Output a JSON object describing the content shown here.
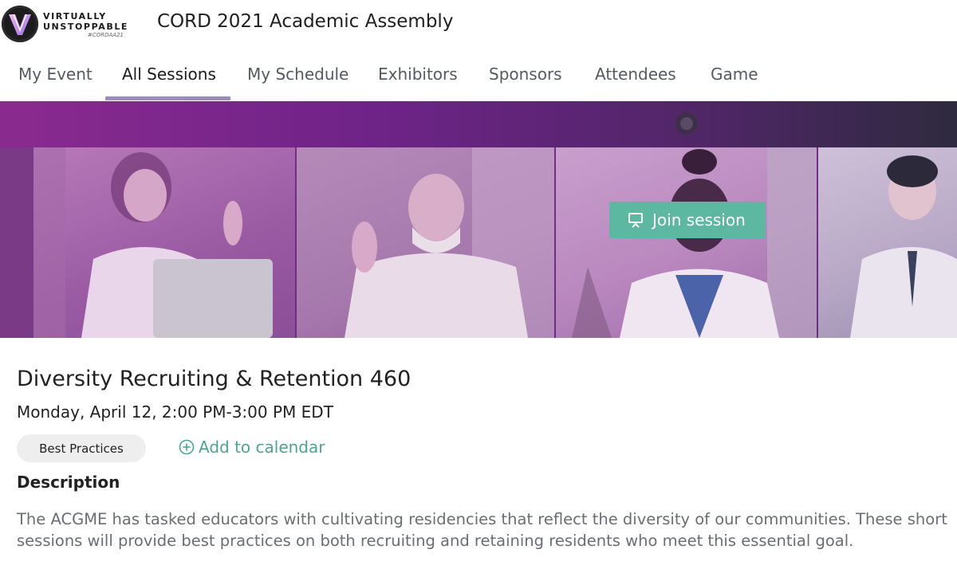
{
  "brand": {
    "logo_line1": "VIRTUALLY",
    "logo_line2": "UNSTOPPABLE",
    "logo_tag": "#CORDAA21",
    "accent_color": "#9a8bc3",
    "button_color": "#5cb8a0"
  },
  "header": {
    "title": "CORD 2021 Academic Assembly"
  },
  "nav": {
    "tabs": [
      {
        "label": "My Event"
      },
      {
        "label": "All Sessions",
        "active": true
      },
      {
        "label": "My Schedule"
      },
      {
        "label": "Exhibitors"
      },
      {
        "label": "Sponsors"
      },
      {
        "label": "Attendees"
      },
      {
        "label": "Game"
      }
    ]
  },
  "banner": {
    "join_label": "Join session",
    "join_icon": "presentation-icon"
  },
  "session": {
    "title": "Diversity Recruiting & Retention 460",
    "datetime": "Monday, April 12, 2:00 PM-3:00 PM EDT",
    "tag": "Best Practices",
    "add_to_calendar": "Add to calendar",
    "add_icon": "plus-circle-icon",
    "description_heading": "Description",
    "description": "The ACGME has tasked educators with cultivating residencies that reflect the diversity of our communities.  These short sessions will provide best practices on both recruiting and retaining residents who meet this essential goal."
  }
}
